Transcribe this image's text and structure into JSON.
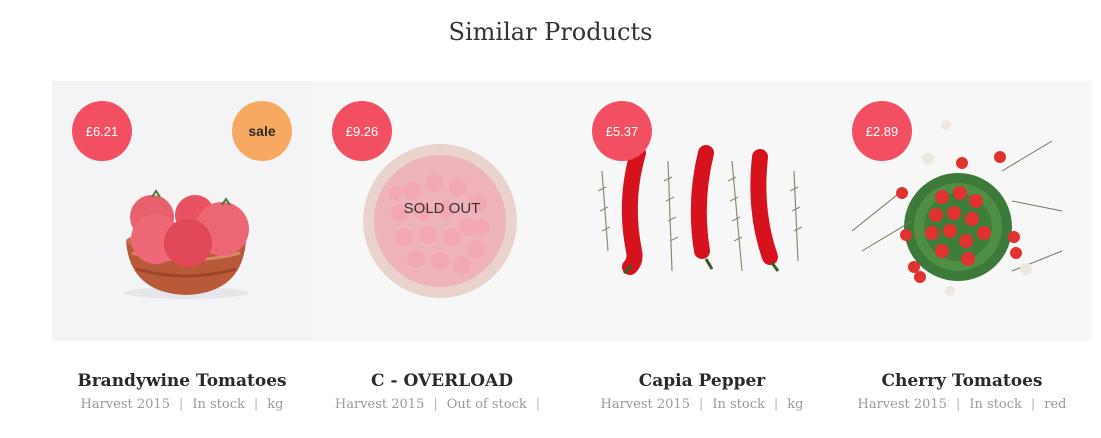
{
  "section": {
    "title": "Similar Products"
  },
  "products": [
    {
      "price": "£6.21",
      "sale_label": "sale",
      "name": "Brandywine Tomatoes",
      "meta": [
        "Harvest 2015",
        "In stock",
        "kg"
      ],
      "image_icon": "tomatoes-in-bowl-icon"
    },
    {
      "price": "£9.26",
      "sold_out_label": "SOLD OUT",
      "name": "C - OVERLOAD",
      "meta": [
        "Harvest 2015",
        "Out of stock",
        ""
      ],
      "image_icon": "raspberries-bowl-icon"
    },
    {
      "price": "£5.37",
      "name": "Capia Pepper",
      "meta": [
        "Harvest 2015",
        "In stock",
        "kg"
      ],
      "image_icon": "red-peppers-icon"
    },
    {
      "price": "£2.89",
      "name": "Cherry Tomatoes",
      "meta": [
        "Harvest 2015",
        "In stock",
        "red"
      ],
      "image_icon": "cherry-tomatoes-icon"
    }
  ],
  "colors": {
    "price_badge": "#f25062",
    "sale_badge": "#f7a962",
    "image_bg": "#f4f4f6"
  }
}
